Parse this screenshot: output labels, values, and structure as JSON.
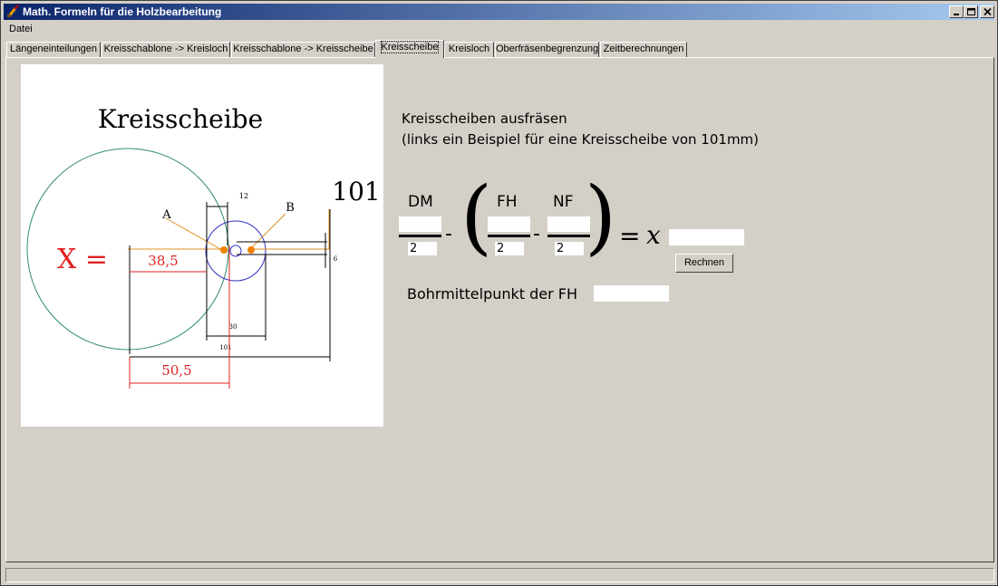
{
  "window": {
    "title": "Math. Formeln für die Holzbearbeitung"
  },
  "menu": {
    "items": [
      "Datei"
    ]
  },
  "tabs": [
    {
      "label": "Längeneinteilungen"
    },
    {
      "label": "Kreisschablone -> Kreisloch"
    },
    {
      "label": "Kreisschablone -> Kreisscheibe"
    },
    {
      "label": "Kreisscheibe"
    },
    {
      "label": "Kreisloch"
    },
    {
      "label": "Oberfräsenbegrenzung"
    },
    {
      "label": "Zeitberechnungen"
    }
  ],
  "active_tab": "Kreisscheibe",
  "diagram": {
    "title": "Kreisscheibe",
    "diameter_label": "101",
    "marker_a": "A",
    "marker_b": "B",
    "x_label": "X =",
    "dim_top": "12",
    "dim_red_top": "38,5",
    "dim_30": "30",
    "dim_101": "101",
    "dim_red_bottom": "50,5",
    "dim_side": "6"
  },
  "main": {
    "heading1": "Kreisscheiben ausfräsen",
    "heading2": "(links ein Beispiel für eine Kreisscheibe von 101mm)"
  },
  "formula": {
    "dm_label": "DM",
    "fh_label": "FH",
    "nf_label": "NF",
    "denominator": "2",
    "equals": "=",
    "x_symbol": "x",
    "result_value": "",
    "dm_value": "",
    "fh_value": "",
    "nf_value": "",
    "calc_button": "Rechnen",
    "bohr_label": "Bohrmittelpunkt der FH",
    "bohr_value": ""
  },
  "statusbar": {
    "text": ""
  }
}
